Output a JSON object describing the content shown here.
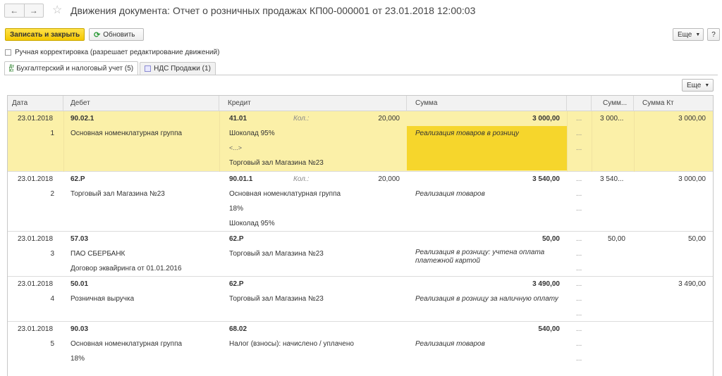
{
  "window": {
    "title": "Движения документа: Отчет о розничных продажах КП00-000001 от 23.01.2018 12:00:03",
    "back": "←",
    "forward": "→",
    "star": "☆"
  },
  "toolbar": {
    "save_close": "Записать и закрыть",
    "refresh": "Обновить",
    "more": "Еще",
    "help": "?"
  },
  "manual_correction": "Ручная корректировка (разрешает редактирование движений)",
  "tabs": [
    {
      "label": "Бухгалтерский и налоговый учет (5)"
    },
    {
      "label": "НДС Продажи (1)"
    }
  ],
  "grid": {
    "more": "Еще",
    "headers": {
      "date": "Дата",
      "debit": "Дебет",
      "credit": "Кредит",
      "sum": "Сумма",
      "sum_dt": "Сумм...",
      "sum_kt": "Сумма Кт"
    },
    "kol_label": "Кол.:",
    "dots": "...",
    "records": [
      {
        "date": "23.01.2018",
        "num": "1",
        "dt_account": "90.02.1",
        "dt_sub1": "Основная номенклатурная группа",
        "dt_sub2": "",
        "dt_sub3": "",
        "ct_account": "41.01",
        "ct_qty": "20,000",
        "ct_sub1": "Шоколад 95%",
        "ct_sub2": "<...>",
        "ct_sub3": "Торговый зал Магазина №23",
        "sum": "3 000,00",
        "content": "Реализация товаров в розницу",
        "sum_dt": "3 000...",
        "sum_kt": "3 000,00"
      },
      {
        "date": "23.01.2018",
        "num": "2",
        "dt_account": "62.Р",
        "dt_sub1": "Торговый зал Магазина №23",
        "dt_sub2": "",
        "dt_sub3": "",
        "ct_account": "90.01.1",
        "ct_qty": "20,000",
        "ct_sub1": "Основная номенклатурная группа",
        "ct_sub2": "18%",
        "ct_sub3": "Шоколад 95%",
        "sum": "3 540,00",
        "content": "Реализация товаров",
        "sum_dt": "3 540...",
        "sum_kt": "3 000,00"
      },
      {
        "date": "23.01.2018",
        "num": "3",
        "dt_account": "57.03",
        "dt_sub1": "ПАО СБЕРБАНК",
        "dt_sub2": "Договор эквайринга от 01.01.2016",
        "dt_sub3": "",
        "ct_account": "62.Р",
        "ct_qty": "",
        "ct_sub1": "Торговый зал Магазина №23",
        "ct_sub2": "",
        "ct_sub3": "",
        "sum": "50,00",
        "content": "Реализация в розницу: учтена оплата платежной картой",
        "sum_dt": "50,00",
        "sum_kt": "50,00"
      },
      {
        "date": "23.01.2018",
        "num": "4",
        "dt_account": "50.01",
        "dt_sub1": "Розничная выручка",
        "dt_sub2": "",
        "dt_sub3": "",
        "ct_account": "62.Р",
        "ct_qty": "",
        "ct_sub1": "Торговый зал Магазина №23",
        "ct_sub2": "",
        "ct_sub3": "",
        "sum": "3 490,00",
        "content": "Реализация в розницу за наличную оплату",
        "sum_dt": "",
        "sum_kt": "3 490,00"
      },
      {
        "date": "23.01.2018",
        "num": "5",
        "dt_account": "90.03",
        "dt_sub1": "Основная номенклатурная группа",
        "dt_sub2": "18%",
        "dt_sub3": "",
        "ct_account": "68.02",
        "ct_qty": "",
        "ct_sub1": "Налог (взносы): начислено / уплачено",
        "ct_sub2": "",
        "ct_sub3": "",
        "sum": "540,00",
        "content": "Реализация товаров",
        "sum_dt": "",
        "sum_kt": ""
      }
    ]
  }
}
